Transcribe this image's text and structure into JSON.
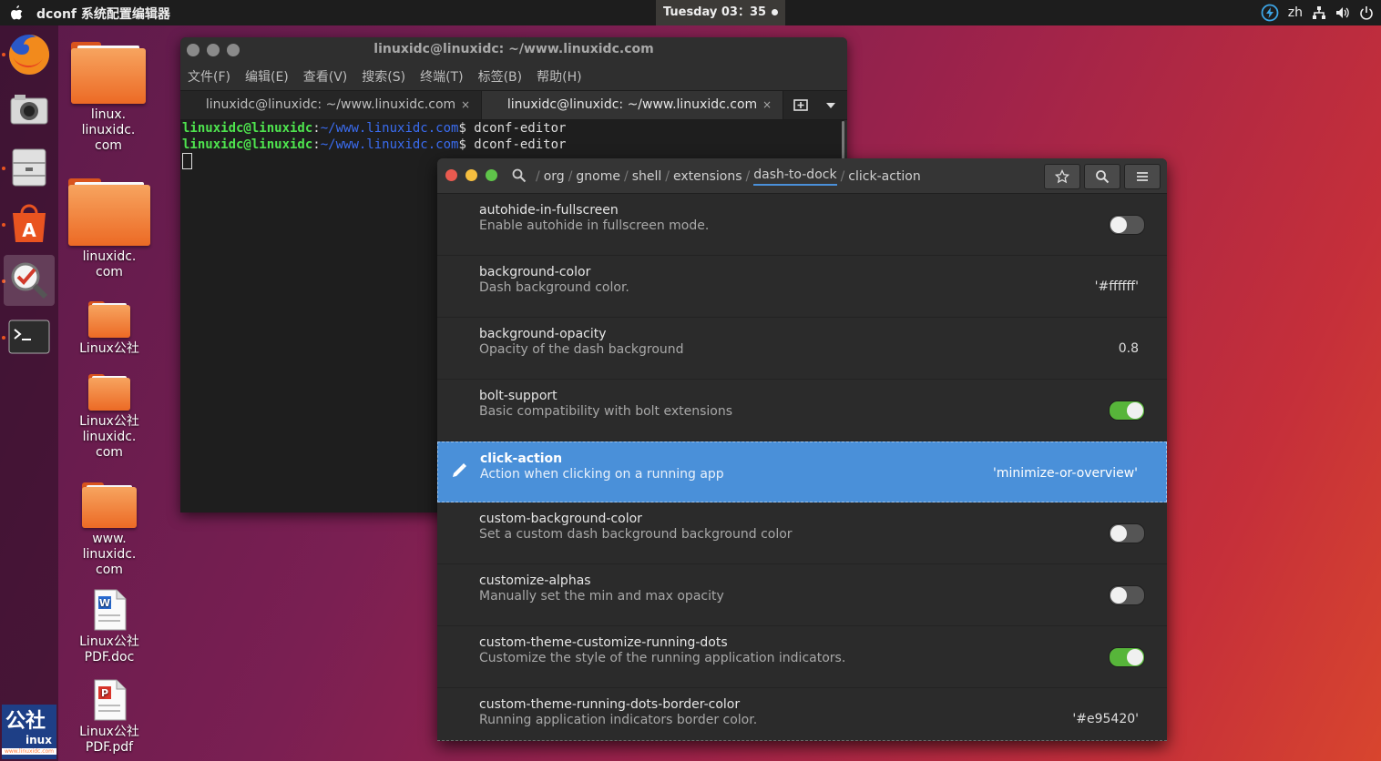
{
  "topbar": {
    "app_title": "dconf 系统配置编辑器",
    "clock": "Tuesday 03：35",
    "lang": "zh"
  },
  "dock": {
    "items": [
      "firefox-icon",
      "camera-icon",
      "files-icon",
      "software-center-icon",
      "dconf-editor-icon",
      "terminal-icon"
    ]
  },
  "desktop": {
    "icons": [
      {
        "label": "linux.\nlinuxidc.\ncom"
      },
      {
        "label": "linuxidc.\ncom"
      },
      {
        "label": "Linux公社"
      },
      {
        "label": "Linux公社\nlinuxidc.\ncom"
      },
      {
        "label": "www.\nlinuxidc.\ncom"
      },
      {
        "label": "Linux公社\nPDF.doc"
      },
      {
        "label": "Linux公社\nPDF.pdf"
      }
    ],
    "logo_text": "公社",
    "logo_sub": "inux",
    "logo_url": "www.linuxidc.com"
  },
  "terminal": {
    "title": "linuxidc@linuxidc: ~/www.linuxidc.com",
    "menu": [
      "文件(F)",
      "编辑(E)",
      "查看(V)",
      "搜索(S)",
      "终端(T)",
      "标签(B)",
      "帮助(H)"
    ],
    "tabs": [
      "linuxidc@linuxidc: ~/www.linuxidc.com",
      "linuxidc@linuxidc: ~/www.linuxidc.com"
    ],
    "tab_close": "×",
    "lines": [
      {
        "user": "linuxidc@linuxidc",
        "colon": ":",
        "path": "~/www.linuxidc.com",
        "cmd": "$ dconf-editor"
      },
      {
        "user": "linuxidc@linuxidc",
        "colon": ":",
        "path": "~/www.linuxidc.com",
        "cmd": "$ dconf-editor"
      }
    ]
  },
  "dconf": {
    "breadcrumb": [
      "/",
      "org",
      "/",
      "gnome",
      "/",
      "shell",
      "/",
      "extensions",
      "/",
      "dash-to-dock",
      "/",
      "click-action"
    ],
    "rows": [
      {
        "name": "autohide-in-fullscreen",
        "desc": "Enable autohide in fullscreen mode.",
        "type": "switch",
        "on": false
      },
      {
        "name": "background-color",
        "desc": "Dash background color.",
        "type": "value",
        "value": "'#ffffff'"
      },
      {
        "name": "background-opacity",
        "desc": "Opacity of the dash background",
        "type": "value",
        "value": "0.8"
      },
      {
        "name": "bolt-support",
        "desc": "Basic compatibility with bolt extensions",
        "type": "switch",
        "on": true
      },
      {
        "name": "click-action",
        "desc": "Action when clicking on a running app",
        "type": "value",
        "value": "'minimize-or-overview'",
        "selected": true
      },
      {
        "name": "custom-background-color",
        "desc": "Set a custom dash background background color",
        "type": "switch",
        "on": false
      },
      {
        "name": "customize-alphas",
        "desc": "Manually set the min and max opacity",
        "type": "switch",
        "on": false
      },
      {
        "name": "custom-theme-customize-running-dots",
        "desc": "Customize the style of the running application indicators.",
        "type": "switch",
        "on": true
      },
      {
        "name": "custom-theme-running-dots-border-color",
        "desc": "Running application indicators border color.",
        "type": "value",
        "value": "'#e95420'"
      }
    ]
  },
  "colors": {
    "accent": "#4a90d9",
    "switch_on": "#57b53a",
    "ubuntu_orange": "#e95420"
  }
}
